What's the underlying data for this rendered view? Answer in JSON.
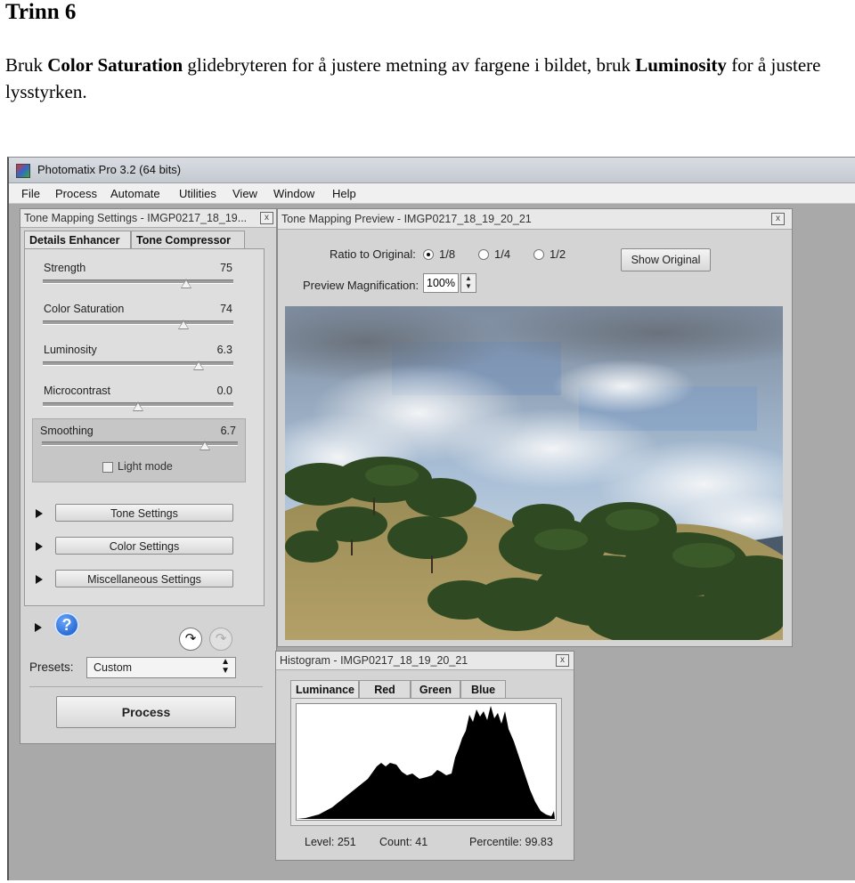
{
  "doc": {
    "heading": "Trinn 6",
    "p_part1": "Bruk ",
    "p_bold1": "Color Saturation",
    "p_part2": " glidebryteren for å justere metning av fargene i bildet, bruk ",
    "p_bold2": "Luminosity",
    "p_part3": " for å justere lysstyrken."
  },
  "app": {
    "title": "Photomatix Pro 3.2 (64 bits)",
    "menu": [
      "File",
      "Process",
      "Automate",
      "Utilities",
      "View",
      "Window",
      "Help"
    ]
  },
  "settings": {
    "title": "Tone Mapping Settings - IMGP0217_18_19...",
    "close": "x",
    "tabs": [
      "Details Enhancer",
      "Tone Compressor"
    ],
    "sliders": [
      {
        "label": "Strength",
        "value": "75",
        "level": 0.75
      },
      {
        "label": "Color Saturation",
        "value": "74",
        "level": 0.74
      },
      {
        "label": "Luminosity",
        "value": "6.3",
        "level": 0.82
      },
      {
        "label": "Microcontrast",
        "value": "0.0",
        "level": 0.5
      },
      {
        "label": "Smoothing",
        "value": "6.7",
        "level": 0.83
      }
    ],
    "light_mode": "Light mode",
    "sections": [
      "Tone Settings",
      "Color Settings",
      "Miscellaneous Settings"
    ],
    "help_icon": "question-icon",
    "presets_label": "Presets:",
    "presets_value": "Custom",
    "process_label": "Process"
  },
  "preview": {
    "title": "Tone Mapping Preview - IMGP0217_18_19_20_21",
    "close": "x",
    "ratio_label": "Ratio to Original:",
    "ratio_options": [
      "1/8",
      "1/4",
      "1/2"
    ],
    "ratio_selected": "1/8",
    "show_original": "Show Original",
    "magnification_label": "Preview Magnification:",
    "magnification_value": "100%"
  },
  "histogram": {
    "title": "Histogram - IMGP0217_18_19_20_21",
    "close": "x",
    "tabs": [
      "Luminance",
      "Red",
      "Green",
      "Blue"
    ],
    "level": "Level: 251",
    "count": "Count: 41",
    "percentile": "Percentile: 99.83"
  },
  "colors": {
    "panel_bg": "#d4d4d4",
    "workspace_bg": "#a9a9a9",
    "help_blue": "#2b6fd6"
  }
}
